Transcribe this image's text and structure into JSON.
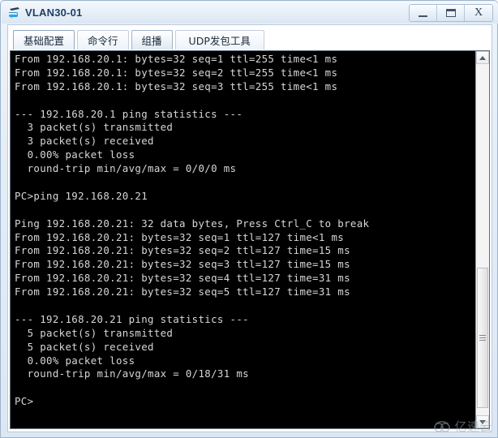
{
  "window": {
    "title": "VLAN30-01",
    "icon": "device-icon",
    "controls": {
      "minimize_label": "—",
      "maximize_label": "▭",
      "close_label": "X"
    }
  },
  "tabs": [
    {
      "label": "基础配置",
      "active": true
    },
    {
      "label": "命令行",
      "active": false
    },
    {
      "label": "组播",
      "active": false
    },
    {
      "label": "UDP发包工具",
      "active": false
    }
  ],
  "terminal": {
    "prompt": "PC>",
    "lines": [
      "From 192.168.20.1: bytes=32 seq=1 ttl=255 time<1 ms",
      "From 192.168.20.1: bytes=32 seq=2 ttl=255 time<1 ms",
      "From 192.168.20.1: bytes=32 seq=3 ttl=255 time<1 ms",
      "",
      "--- 192.168.20.1 ping statistics ---",
      "  3 packet(s) transmitted",
      "  3 packet(s) received",
      "  0.00% packet loss",
      "  round-trip min/avg/max = 0/0/0 ms",
      "",
      "PC>ping 192.168.20.21",
      "",
      "Ping 192.168.20.21: 32 data bytes, Press Ctrl_C to break",
      "From 192.168.20.21: bytes=32 seq=1 ttl=127 time<1 ms",
      "From 192.168.20.21: bytes=32 seq=2 ttl=127 time=15 ms",
      "From 192.168.20.21: bytes=32 seq=3 ttl=127 time=15 ms",
      "From 192.168.20.21: bytes=32 seq=4 ttl=127 time=31 ms",
      "From 192.168.20.21: bytes=32 seq=5 ttl=127 time=31 ms",
      "",
      "--- 192.168.20.21 ping statistics ---",
      "  5 packet(s) transmitted",
      "  5 packet(s) received",
      "  0.00% packet loss",
      "  round-trip min/avg/max = 0/18/31 ms",
      "",
      "PC>"
    ]
  },
  "scrollbar": {
    "up_arrow": "scroll-up-arrow",
    "down_arrow": "scroll-down-arrow",
    "thumb_top_pct": 58,
    "thumb_height_pct": 40
  },
  "watermark": {
    "text": "亿速云"
  },
  "colors": {
    "terminal_bg": "#000000",
    "terminal_fg": "#d7d7d7",
    "title_fg": "#1f3f66",
    "frame": "#dde7f3"
  }
}
